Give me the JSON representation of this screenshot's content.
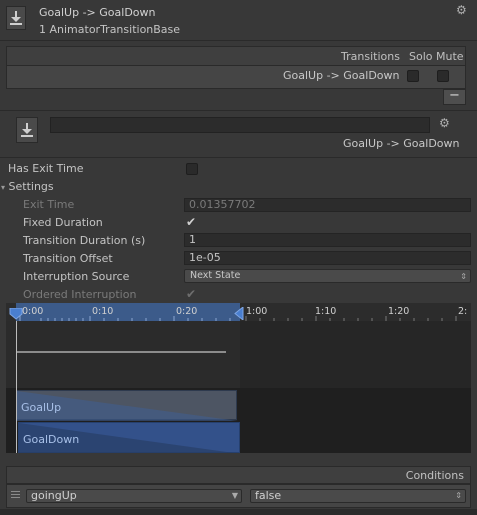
{
  "header": {
    "title": "GoalUp -> GoalDown",
    "subtitle": "1 AnimatorTransitionBase",
    "gear_icon": "gear-icon"
  },
  "transitions": {
    "header_label": "Transitions",
    "solo_label": "Solo",
    "mute_label": "Mute",
    "rows": [
      {
        "name": "GoalUp -> GoalDown",
        "solo": false,
        "mute": false
      }
    ],
    "remove_label": "−"
  },
  "inspector": {
    "name_value": "",
    "transition_label": "GoalUp -> GoalDown",
    "has_exit_time_label": "Has Exit Time",
    "has_exit_time": false,
    "settings_label": "Settings",
    "exit_time_label": "Exit Time",
    "exit_time_value": "0.01357702",
    "fixed_duration_label": "Fixed Duration",
    "fixed_duration": true,
    "transition_duration_label": "Transition Duration (s)",
    "transition_duration_value": "1",
    "transition_offset_label": "Transition Offset",
    "transition_offset_value": "1e-05",
    "interruption_source_label": "Interruption Source",
    "interruption_source_value": "Next State",
    "ordered_interruption_label": "Ordered Interruption",
    "ordered_interruption": true
  },
  "timeline": {
    "ticks": [
      "0:00",
      "0:10",
      "0:20",
      "1:00",
      "1:10",
      "1:20",
      "2:"
    ],
    "clip_from": "GoalUp",
    "clip_to": "GoalDown"
  },
  "conditions": {
    "header_label": "Conditions",
    "rows": [
      {
        "parameter": "goingUp",
        "value": "false"
      }
    ]
  }
}
